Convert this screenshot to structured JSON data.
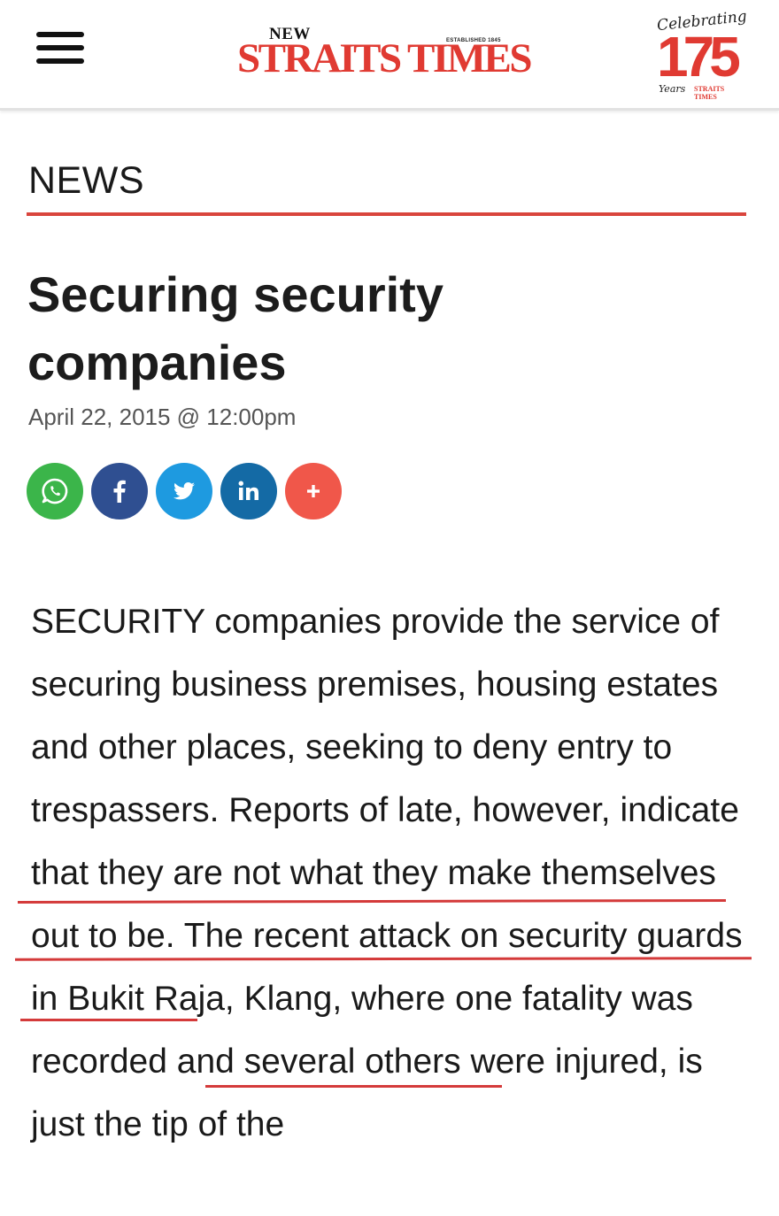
{
  "header": {
    "logo_new": "NEW",
    "logo_established": "ESTABLISHED 1845",
    "logo_main": "STRAITS TIMES",
    "badge": {
      "celebrating": "Celebrating",
      "number": "175",
      "years": "Years",
      "brand": "STRAITS TIMES"
    }
  },
  "section": {
    "label": "NEWS"
  },
  "article": {
    "title": "Securing security companies",
    "date": "April 22, 2015 @ 12:00pm",
    "paragraph": "SECURITY companies provide the service of securing business premises, housing estates and other places, seeking to deny entry to trespassers. Reports of late, however, indicate that they are not what they make themselves out to be. The recent attack on security guards in Bukit Raja, Klang, where one fatality was recorded and several others were injured, is just the tip of the"
  },
  "share": [
    {
      "name": "whatsapp",
      "icon": "whatsapp-icon",
      "color": "#3bb54a"
    },
    {
      "name": "facebook",
      "icon": "facebook-icon",
      "color": "#2f4f91"
    },
    {
      "name": "twitter",
      "icon": "twitter-icon",
      "color": "#1e9ae0"
    },
    {
      "name": "linkedin",
      "icon": "linkedin-icon",
      "color": "#146aa5"
    },
    {
      "name": "more",
      "icon": "plus-icon",
      "color": "#f0574a"
    }
  ],
  "colors": {
    "brand_red": "#e03a32",
    "rule_red": "#d9453d",
    "annotation_red": "#d43a3a"
  }
}
